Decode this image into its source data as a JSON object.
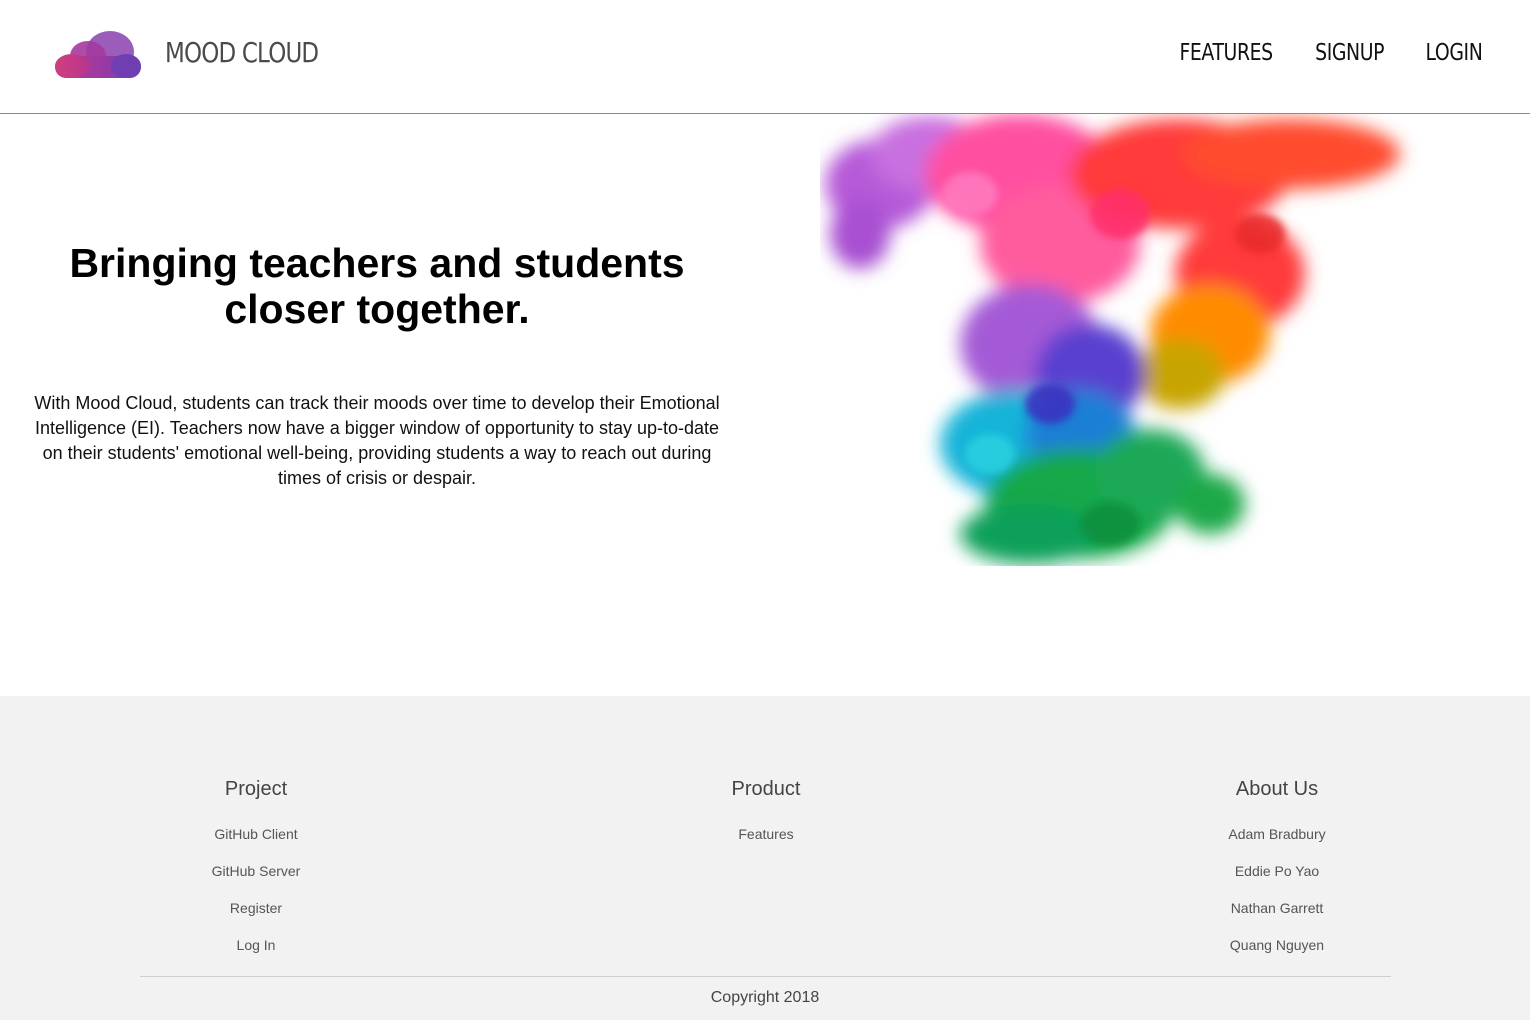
{
  "header": {
    "brand": "MOOD CLOUD",
    "logo_icon": "cloud-icon",
    "logo_colors": [
      "#c0368a",
      "#8e3fa8",
      "#6b3fb4"
    ],
    "nav": [
      {
        "label": "FEATURES"
      },
      {
        "label": "SIGNUP"
      },
      {
        "label": "LOGIN"
      }
    ]
  },
  "hero": {
    "title": "Bringing teachers and students closer together.",
    "description": "With Mood Cloud, students can track their moods over time to develop their Emotional Intelligence (EI). Teachers now have a bigger window of opportunity to stay up-to-date on their students' emotional well-being, providing students a way to reach out during times of crisis or despair.",
    "image": "rainbow-smoke-illustration",
    "image_colors": [
      "#b65ad8",
      "#ff4f9a",
      "#ff3b30",
      "#ff8a00",
      "#1aa8e0",
      "#12a84a"
    ]
  },
  "footer": {
    "columns": [
      {
        "title": "Project",
        "links": [
          "GitHub Client",
          "GitHub Server",
          "Register",
          "Log In"
        ]
      },
      {
        "title": "Product",
        "links": [
          "Features"
        ]
      },
      {
        "title": "About Us",
        "links": [
          "Adam Bradbury",
          "Eddie Po Yao",
          "Nathan Garrett",
          "Quang Nguyen"
        ]
      }
    ],
    "copyright": "Copyright 2018",
    "background": "#f2f2f2"
  }
}
